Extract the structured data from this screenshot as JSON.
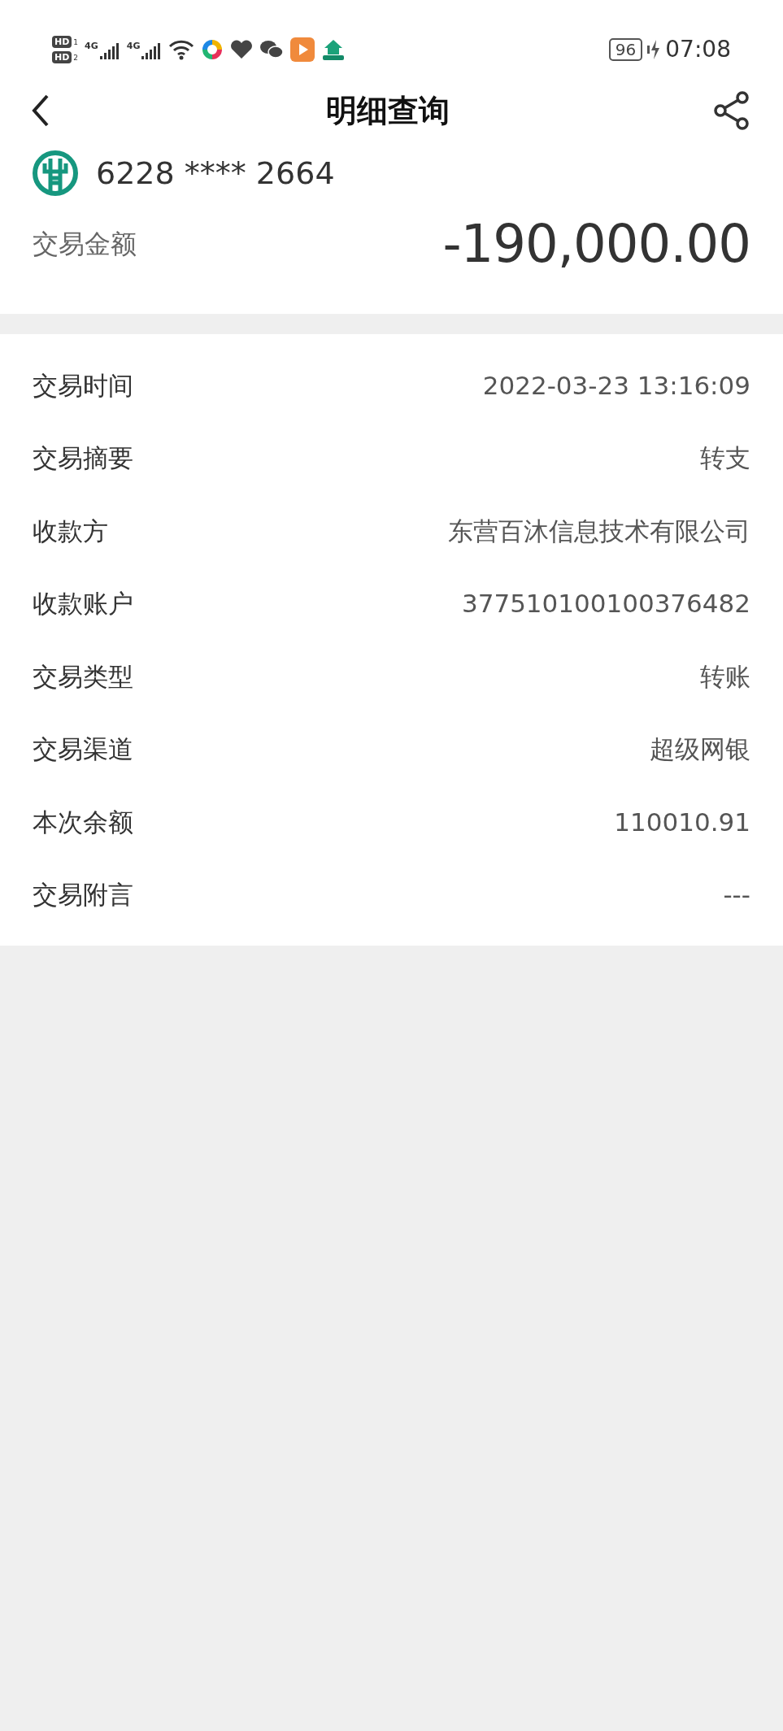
{
  "status_bar": {
    "sim_badges": [
      {
        "label": "HD",
        "slot": "1"
      },
      {
        "label": "HD",
        "slot": "2"
      }
    ],
    "networks": [
      "4G",
      "4G"
    ],
    "battery": "96",
    "time": "07:08"
  },
  "header": {
    "title": "明细查询"
  },
  "summary": {
    "card_number": "6228 **** 2664",
    "amount_label": "交易金额",
    "amount": "-190,000.00"
  },
  "details": [
    {
      "label": "交易时间",
      "value": "2022-03-23 13:16:09"
    },
    {
      "label": "交易摘要",
      "value": "转支"
    },
    {
      "label": "收款方",
      "value": "东营百沐信息技术有限公司"
    },
    {
      "label": "收款账户",
      "value": "377510100100376482"
    },
    {
      "label": "交易类型",
      "value": "转账"
    },
    {
      "label": "交易渠道",
      "value": "超级网银"
    },
    {
      "label": "本次余额",
      "value": "110010.91"
    },
    {
      "label": "交易附言",
      "value": "---"
    }
  ]
}
